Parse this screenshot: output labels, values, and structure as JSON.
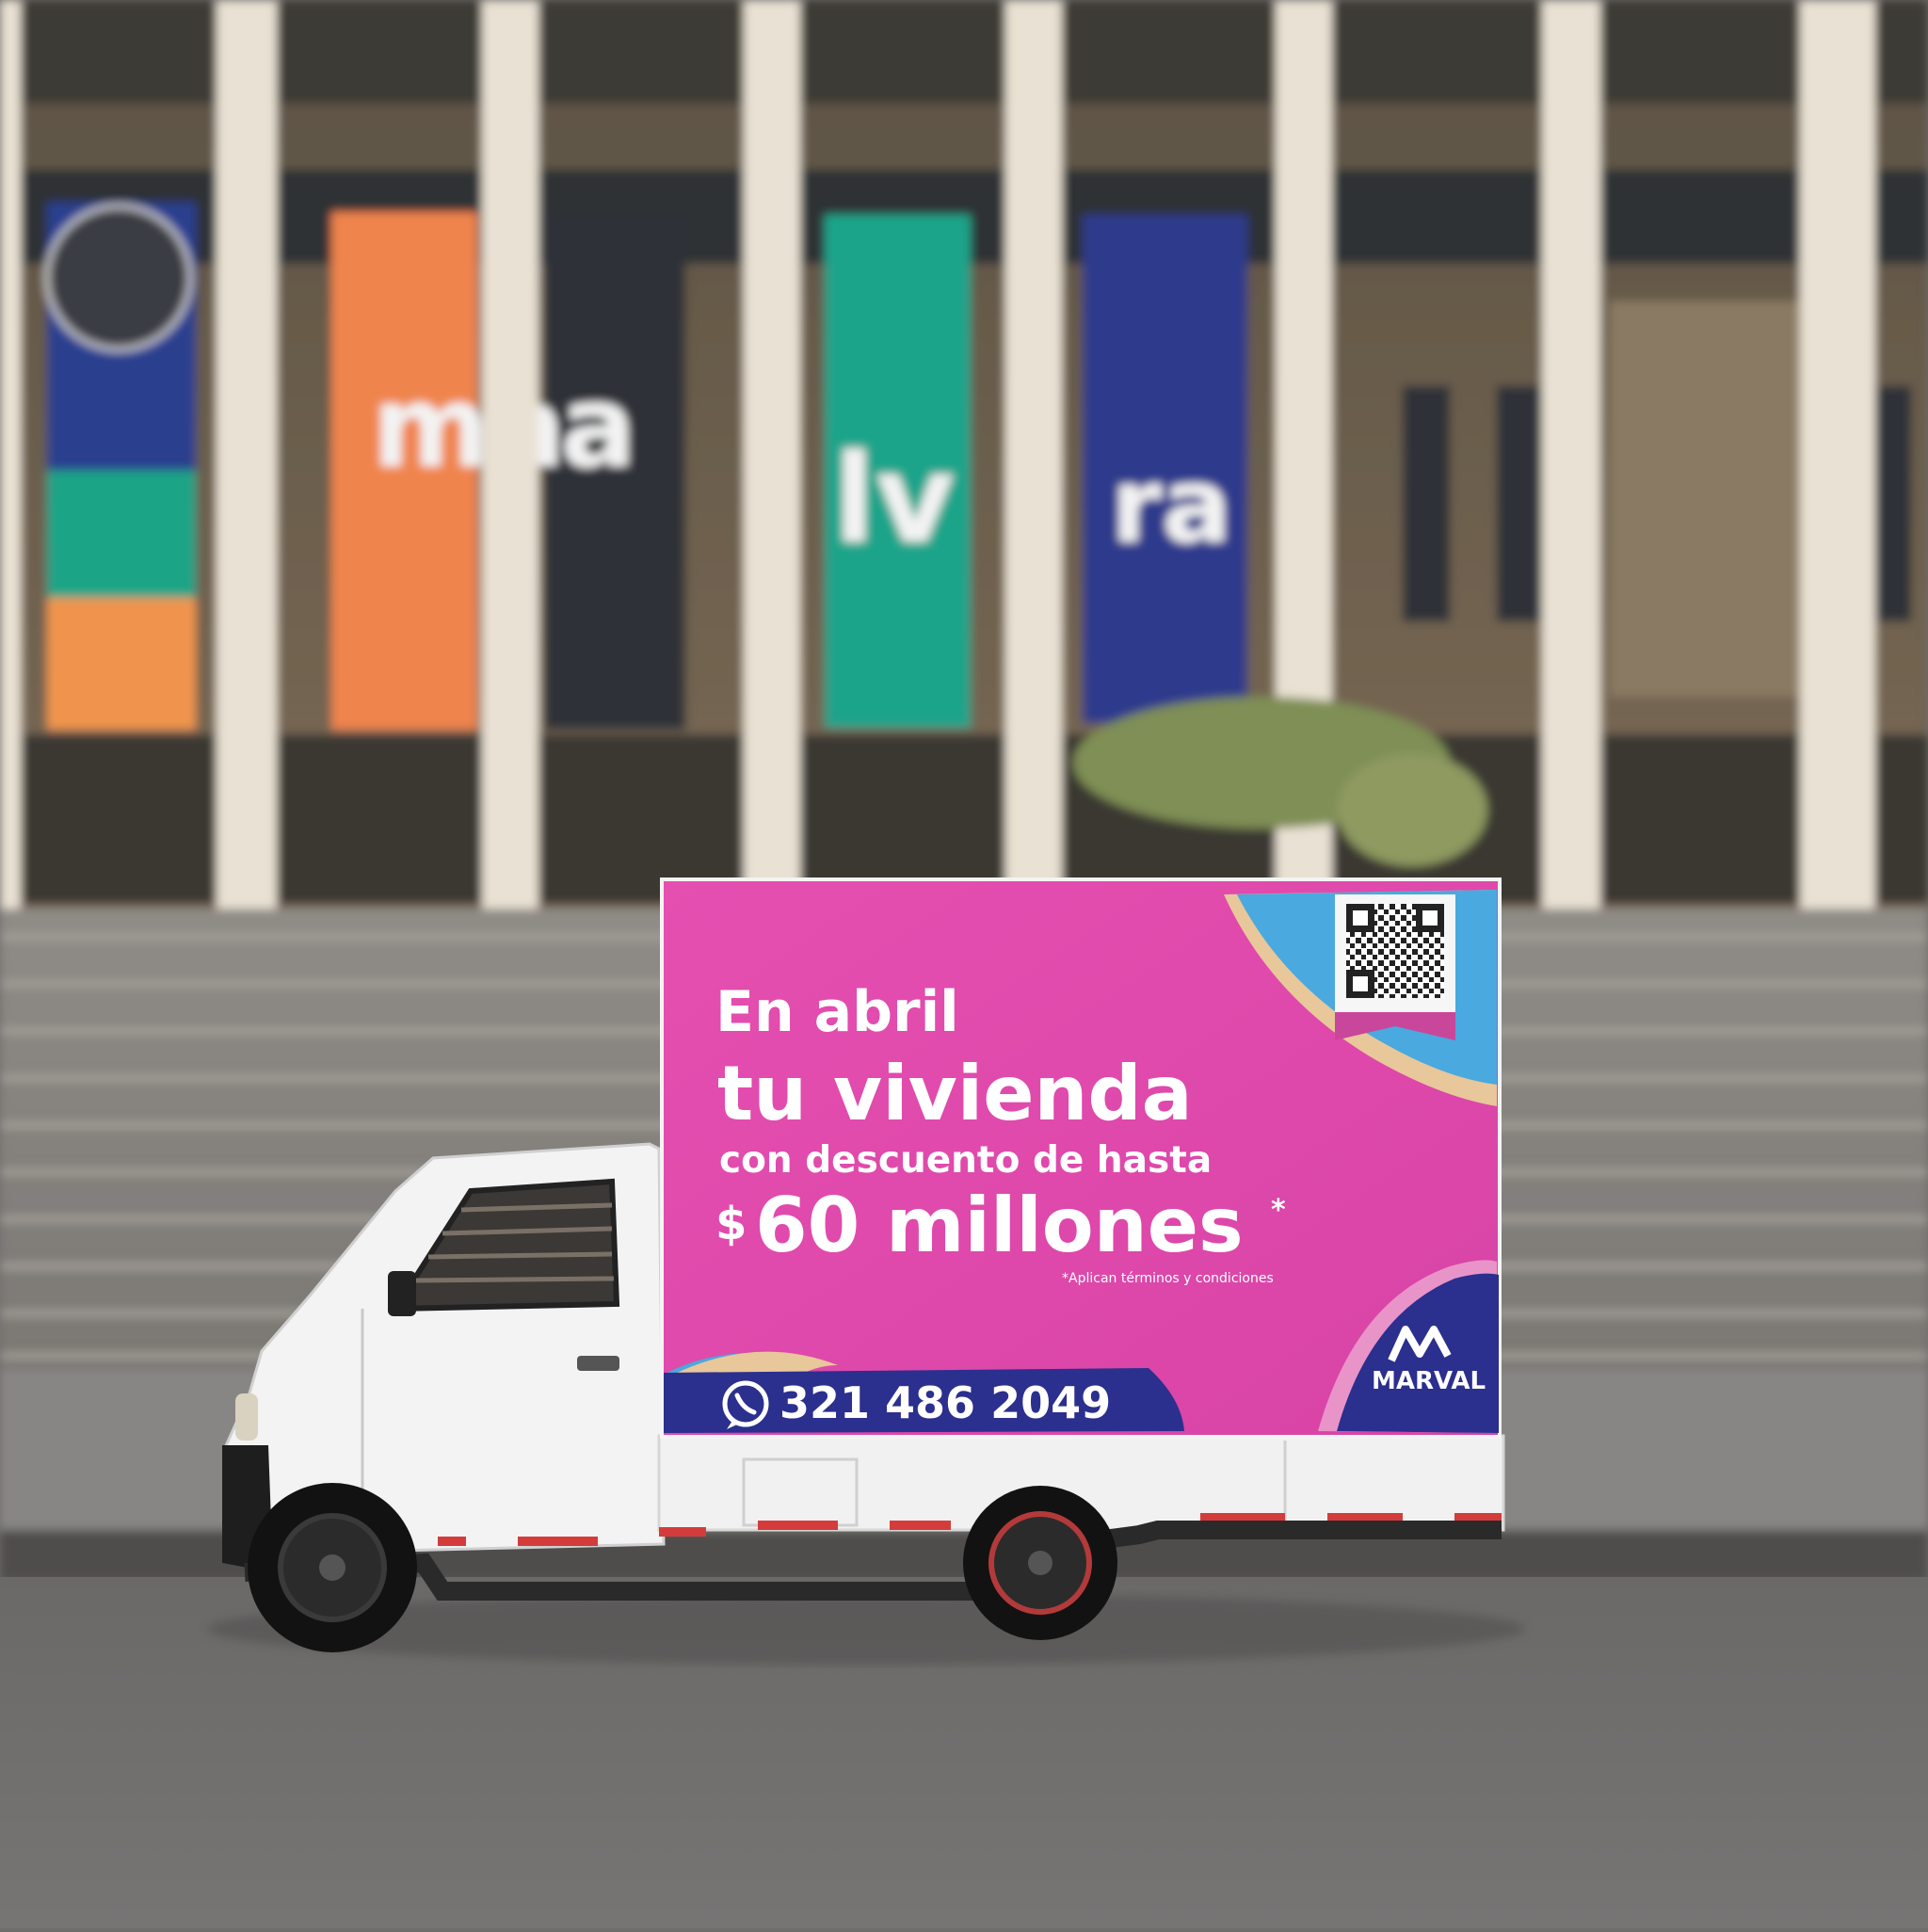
{
  "billboard": {
    "line1": "En abril",
    "line2": "tu vivienda",
    "line3": "con descuento de hasta",
    "price_symbol": "$",
    "line4": "60 millones",
    "asterisk": "*",
    "disclaimer": "*Aplican términos y condiciones",
    "phone": "321 486 2049",
    "brand": "MARVAL",
    "colors": {
      "magenta": "#e04aaa",
      "navy": "#2b2f8e",
      "sky": "#4aa9de",
      "sand": "#e8c79a"
    }
  },
  "building_banners": [
    {
      "color": "#f0844e",
      "text": "ma"
    },
    {
      "color": "#2e3138",
      "text": "a"
    },
    {
      "color": "#1aa48a",
      "text": "lv"
    },
    {
      "color": "#2d3a8c",
      "text": "ra"
    }
  ],
  "icons": [
    "whatsapp-icon",
    "qr-code",
    "marval-logo"
  ]
}
